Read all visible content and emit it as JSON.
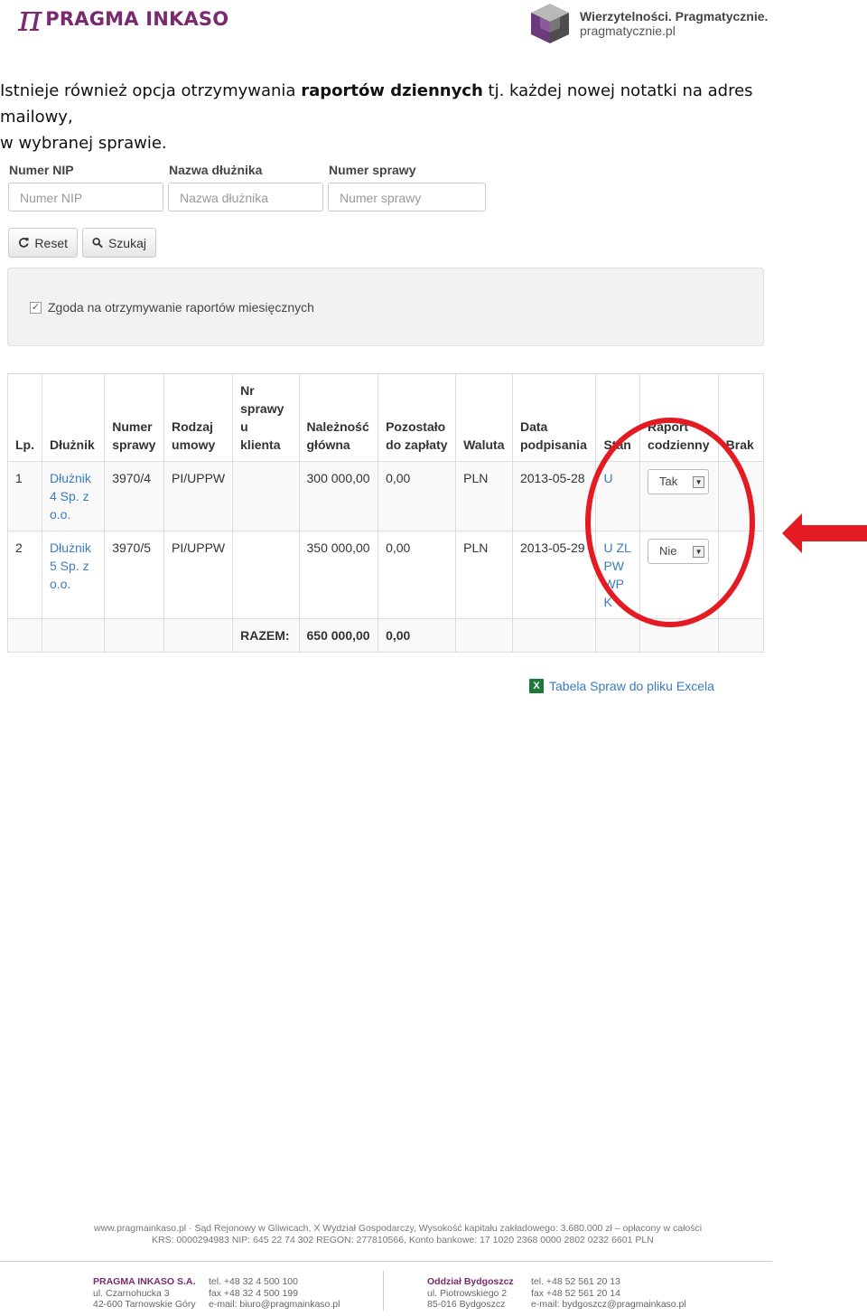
{
  "header": {
    "left_logo_symbol": "π",
    "left_logo_text": "PRAGMA INKASO",
    "right_logo_line1": "Wierzytelności. Pragmatycznie.",
    "right_logo_line2": "pragmatycznie.pl"
  },
  "intro": {
    "before": "Istnieje również opcja otrzymywania ",
    "bold": "raportów dziennych",
    "after": " tj. każdej nowej notatki na adres mailowy,",
    "line2": "w wybranej sprawie."
  },
  "form": {
    "nip_label": "Numer NIP",
    "nip_placeholder": "Numer NIP",
    "debtor_label": "Nazwa dłużnika",
    "debtor_placeholder": "Nazwa dłużnika",
    "case_label": "Numer sprawy",
    "case_placeholder": "Numer sprawy",
    "reset_label": "Reset",
    "search_label": "Szukaj",
    "monthly_consent_label": "Zgoda na otrzymywanie raportów miesięcznych",
    "monthly_consent_checked": true
  },
  "table": {
    "headers": {
      "lp": "Lp.",
      "debtor": "Dłużnik",
      "case_no": [
        "Numer",
        "sprawy"
      ],
      "contract": [
        "Rodzaj",
        "umowy"
      ],
      "client_case": [
        "Nr",
        "sprawy",
        "u",
        "klienta"
      ],
      "principal": [
        "Należność",
        "główna"
      ],
      "remaining": [
        "Pozostało",
        "do zapłaty"
      ],
      "currency": "Waluta",
      "signed": [
        "Data",
        "podpisania"
      ],
      "status": "Stan",
      "daily_report": [
        "Raport",
        "codzienny"
      ],
      "missing": "Brak"
    },
    "rows": [
      {
        "lp": "1",
        "debtor": [
          "Dłużnik",
          "4 Sp. z",
          "o.o."
        ],
        "case_no": "3970/4",
        "contract": "PI/UPPW",
        "client_case": "",
        "principal": "300 000,00",
        "remaining": "0,00",
        "currency": "PLN",
        "signed": "2013-05-28",
        "status": [
          "U"
        ],
        "daily_report": "Tak",
        "missing": ""
      },
      {
        "lp": "2",
        "debtor": [
          "Dłużnik",
          "5 Sp. z",
          "o.o."
        ],
        "case_no": "3970/5",
        "contract": "PI/UPPW",
        "client_case": "",
        "principal": "350 000,00",
        "remaining": "0,00",
        "currency": "PLN",
        "signed": "2013-05-29",
        "status": [
          "U ZL",
          "PW",
          "WP",
          "K"
        ],
        "daily_report": "Nie",
        "missing": ""
      }
    ],
    "total_label": "RAZEM:",
    "total_principal": "650 000,00",
    "total_remaining": "0,00"
  },
  "excel_link": "Tabela Spraw do pliku Excela",
  "annotation_color": "#e51b24",
  "footer": {
    "line1": "www.pragmainkaso.pl · Sąd Rejonowy w Gliwicach, X Wydział Gospodarczy, Wysokość kapitału zakładowego: 3.680.000 zł – opłacony w całości",
    "line2": "KRS: 0000294983 NIP: 645 22 74 302 REGON: 277810566, Konto bankowe: 17 1020 2368 0000 2802 0232 6601 PLN",
    "hq_name": "PRAGMA INKASO S.A.",
    "hq_street": "ul. Czarnohucka 3",
    "hq_city": "42-600 Tarnowskie Góry",
    "hq_tel": "tel. +48 32 4 500 100",
    "hq_fax": "fax +48 32 4 500 199",
    "hq_email": "e-mail: biuro@pragmainkaso.pl",
    "branch_name": "Oddział Bydgoszcz",
    "branch_street": "ul. Piotrowskiego 2",
    "branch_city": "85-016 Bydgoszcz",
    "branch_tel": "tel. +48 52 561 20 13",
    "branch_fax": "fax +48 52 561 20 14",
    "branch_email": "e-mail: bydgoszcz@pragmainkaso.pl"
  }
}
